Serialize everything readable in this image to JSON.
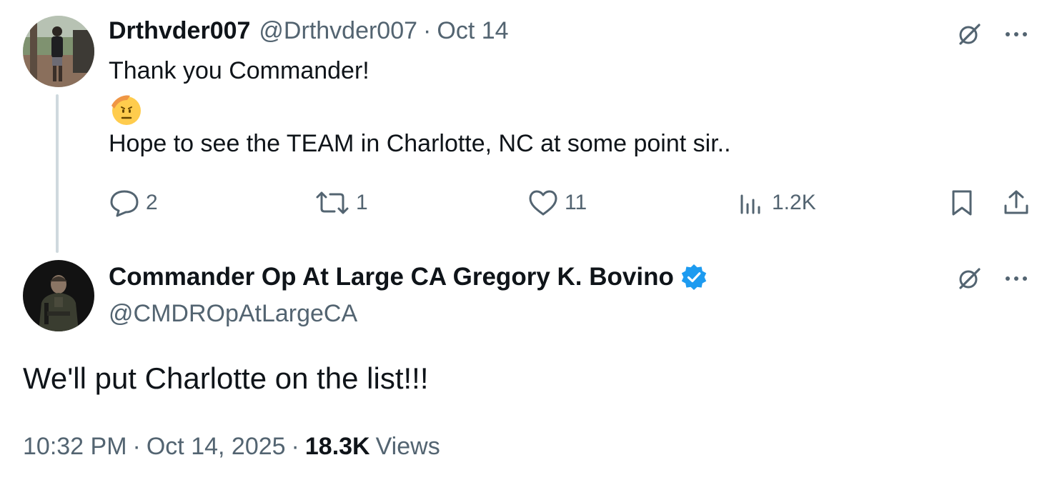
{
  "reply": {
    "display_name": "Drthvder007",
    "handle": "@Drthvder007",
    "separator": "·",
    "date": "Oct 14",
    "text_line1": "Thank you Commander!",
    "emoji": "🫡",
    "text_line2": "Hope to see the TEAM in Charlotte, NC at some point sir..",
    "stats": {
      "replies": "2",
      "reposts": "1",
      "likes": "11",
      "views": "1.2K"
    },
    "icons": [
      "grok-icon",
      "more-icon",
      "reply-icon",
      "repost-icon",
      "like-icon",
      "views-icon",
      "bookmark-icon",
      "share-icon"
    ]
  },
  "main": {
    "display_name": "Commander Op At Large CA Gregory K. Bovino",
    "handle": "@CMDROpAtLargeCA",
    "text": "We'll put Charlotte on the list!!!",
    "time": "10:32 PM",
    "separator": "·",
    "date": "Oct 14, 2025",
    "views_count": "18.3K",
    "views_label": "Views"
  },
  "colors": {
    "text_primary": "#0f1419",
    "text_secondary": "#536471",
    "verified_blue": "#1d9bf0",
    "thread_line": "#cfd9de"
  }
}
